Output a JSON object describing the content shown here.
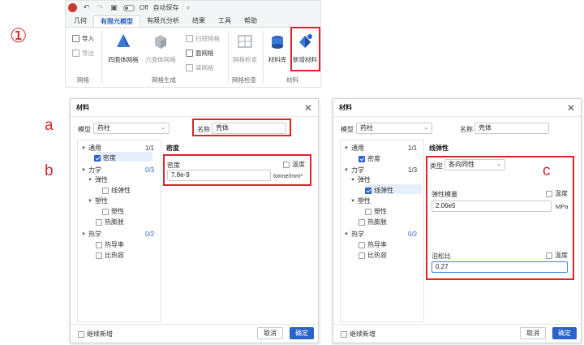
{
  "annotations": {
    "step": "①",
    "a": "a",
    "b": "b",
    "c": "c"
  },
  "ribbon": {
    "quick_access": {
      "toggle_label": "Off",
      "autosave_label": "自动保存"
    },
    "tabs": [
      {
        "label": "几何",
        "active": false
      },
      {
        "label": "有限元模型",
        "active": true
      },
      {
        "label": "有限元分析",
        "active": false
      },
      {
        "label": "结果",
        "active": false
      },
      {
        "label": "工具",
        "active": false
      },
      {
        "label": "帮助",
        "active": false
      }
    ],
    "buttons": {
      "import": "导入",
      "export": "导出",
      "tet_mesh": "四面体网格",
      "hex_mesh": "六面体网格",
      "sweep_mesh": "扫掠网格",
      "surface_mesh": "面网格",
      "beam_mesh": "梁网格",
      "mesh_check": "网格检查",
      "material_lib": "材料库",
      "new_material": "新增材料"
    },
    "group_labels": {
      "mesh": "网格",
      "mesh_gen": "网格生成",
      "mesh_check": "网格检查",
      "material": "材料"
    }
  },
  "dialog_left": {
    "title": "材料",
    "model_label": "模型",
    "model_value": "药柱",
    "name_label": "名称",
    "name_value": "壳体",
    "tree": {
      "general": "通用",
      "general_count": "1/1",
      "density": "密度",
      "mechanics": "力学",
      "mechanics_count": "0/3",
      "elasticity": "弹性",
      "linear_elastic": "线弹性",
      "plasticity": "塑性",
      "plastic": "塑性",
      "thermal_expansion": "热膨胀",
      "thermal": "热学",
      "thermal_count": "0/2",
      "conductivity": "热导率",
      "specific_heat": "比热容"
    },
    "section_title": "密度",
    "density_label": "密度",
    "temperature_label": "温度",
    "density_value": "7.8e-9",
    "density_unit": "tonne/mm³",
    "continue_label": "继续新增",
    "cancel": "取消",
    "ok": "确定"
  },
  "dialog_right": {
    "title": "材料",
    "model_label": "模型",
    "model_value": "药柱",
    "name_label": "名称",
    "name_value": "壳体",
    "tree": {
      "general": "通用",
      "general_count": "1/1",
      "density": "密度",
      "mechanics": "力学",
      "mechanics_count": "1/3",
      "elasticity": "弹性",
      "linear_elastic": "线弹性",
      "plasticity": "塑性",
      "plastic": "塑性",
      "thermal_expansion": "热膨胀",
      "thermal": "热学",
      "thermal_count": "0/2",
      "conductivity": "热导率",
      "specific_heat": "比热容"
    },
    "section_title": "线弹性",
    "type_label": "类型",
    "type_value": "各向同性",
    "modulus_label": "弹性模量",
    "temperature_label": "温度",
    "modulus_value": "2.06e5",
    "modulus_unit": "MPa",
    "poisson_label": "泊松比",
    "poisson_value": "0.27",
    "continue_label": "继续新增",
    "cancel": "取消",
    "ok": "确定"
  },
  "colors": {
    "accent": "#2a63c9",
    "annotation_red": "#d8262b",
    "selection": "#e5eefb"
  }
}
